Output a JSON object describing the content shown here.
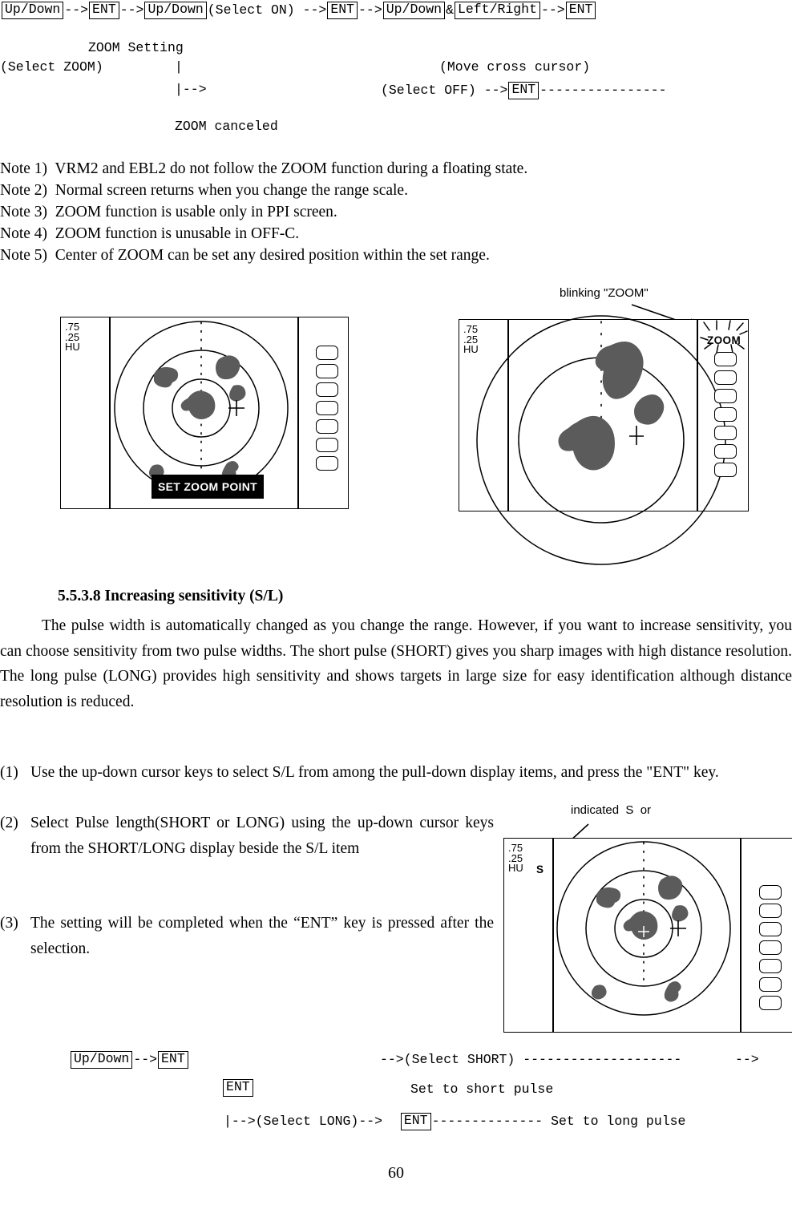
{
  "top_flow": {
    "row1": [
      {
        "type": "key",
        "text": "Up/Down"
      },
      {
        "type": "arrow",
        "text": "-->"
      },
      {
        "type": "key",
        "text": "ENT"
      },
      {
        "type": "arrow",
        "text": "-->"
      },
      {
        "type": "key",
        "text": "Up/Down"
      },
      {
        "type": "text",
        "text": "  (Select ON) -->"
      },
      {
        "type": "key",
        "text": "ENT"
      },
      {
        "type": "arrow",
        "text": "-->"
      },
      {
        "type": "key",
        "text": "Up/Down"
      },
      {
        "type": "text",
        "text": "&"
      },
      {
        "type": "key",
        "text": "Left/Right "
      },
      {
        "type": "text",
        "text": "  -->"
      },
      {
        "type": "key",
        "text": "ENT"
      }
    ],
    "zoom_setting_label": "ZOOM Setting",
    "select_zoom_label": "(Select ZOOM)",
    "pipe_char": "|",
    "branch_char": "|-->",
    "move_cross_cursor_label": "(Move cross cursor)",
    "select_off_label": "(Select OFF) -->",
    "select_off_key": "ENT",
    "select_off_dashes": "----------------",
    "zoom_canceled_label": "ZOOM canceled"
  },
  "notes": [
    "Note 1)  VRM2 and EBL2 do not follow the ZOOM function during a floating state.",
    "Note 2)  Normal screen returns when you change the range scale.",
    "Note 3)  ZOOM function is usable only in PPI screen.",
    "Note 4)  ZOOM function is unusable in OFF-C.",
    "Note 5)  Center of ZOOM can be set any desired position within the set range."
  ],
  "figure_left": {
    "range_label": ".75\n.25\nHU",
    "banner_text": "SET ZOOM POINT",
    "softkey_count": 7
  },
  "figure_right": {
    "range_label": ".75\n.25\nHU",
    "zoom_tag": "ZOOM",
    "callout": "blinking \"ZOOM\"",
    "softkey_count": 7
  },
  "section": {
    "heading": "5.5.3.8 Increasing sensitivity (S/L)",
    "paragraph": "The pulse width is automatically changed as you change the range. However, if you want to increase sensitivity, you can choose sensitivity from two pulse widths. The short pulse (SHORT) gives you sharp images with high distance resolution. The long pulse (LONG) provides high sensitivity and shows targets in large size for easy identification although distance resolution is reduced.",
    "items": [
      {
        "label": "(1)",
        "text": "Use the up-down cursor keys to select S/L from among the pull-down display items, and press the \"ENT\" key."
      },
      {
        "label": "(2)",
        "text": "Select Pulse length(SHORT or LONG) using the up-down cursor keys from the SHORT/LONG display beside the S/L item"
      },
      {
        "label": "(3)",
        "text": "The setting will be completed when the “ENT” key is pressed after the selection."
      }
    ]
  },
  "figure_sl": {
    "range_label": ".75\n.25\nHU",
    "sl_letter": "S",
    "callout": "indicated  S  or",
    "softkey_count": 7
  },
  "bottom_flow": {
    "row1_key1": "Up/Down",
    "row1_arrow": "-->",
    "row1_key2": "ENT",
    "row1_select_short": "-->(Select SHORT) --------------------",
    "row1_tail_arrow": "-->",
    "row2_key": "ENT",
    "row2_text": "Set to short pulse",
    "row3_branch": "|-->(Select LONG)-->",
    "row3_key": "ENT",
    "row3_text": "-------------- Set to long pulse"
  },
  "page_number": "60"
}
